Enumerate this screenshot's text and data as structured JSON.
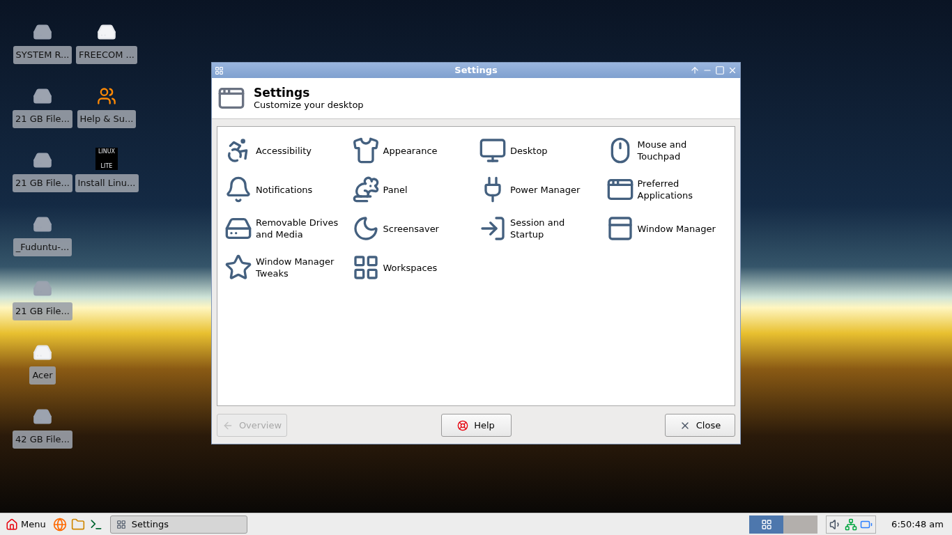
{
  "desktop_icon_columns": [
    {
      "icons": [
        {
          "label": "SYSTEM R...",
          "kind": "drive"
        },
        {
          "label": "21 GB File...",
          "kind": "drive"
        },
        {
          "label": "21 GB File...",
          "kind": "drive"
        },
        {
          "label": "_Fuduntu-...",
          "kind": "drive"
        },
        {
          "label": "21 GB File...",
          "kind": "drive"
        },
        {
          "label": "Acer",
          "kind": "drive-light"
        },
        {
          "label": "42 GB File...",
          "kind": "drive"
        }
      ]
    },
    {
      "icons": [
        {
          "label": "FREECOM ...",
          "kind": "drive-light"
        },
        {
          "label": "Help & Su...",
          "kind": "users"
        },
        {
          "label": "Install Linu...",
          "kind": "logo",
          "logo_lines": [
            "LINUX",
            "LITE"
          ]
        }
      ]
    }
  ],
  "window": {
    "title": "Settings",
    "header_title": "Settings",
    "header_subtitle": "Customize your desktop",
    "items": [
      {
        "label": "Accessibility",
        "kind": "accessibility"
      },
      {
        "label": "Appearance",
        "kind": "appearance"
      },
      {
        "label": "Desktop",
        "kind": "desktop"
      },
      {
        "label": "Mouse and Touchpad",
        "kind": "mouse"
      },
      {
        "label": "Notifications",
        "kind": "notifications"
      },
      {
        "label": "Panel",
        "kind": "panel"
      },
      {
        "label": "Power Manager",
        "kind": "power"
      },
      {
        "label": "Preferred Applications",
        "kind": "preferred"
      },
      {
        "label": "Removable Drives and Media",
        "kind": "drives"
      },
      {
        "label": "Screensaver",
        "kind": "screensaver"
      },
      {
        "label": "Session and Startup",
        "kind": "session"
      },
      {
        "label": "Window Manager",
        "kind": "wm"
      },
      {
        "label": "Window Manager Tweaks",
        "kind": "tweaks"
      },
      {
        "label": "Workspaces",
        "kind": "workspaces"
      }
    ],
    "buttons": [
      {
        "label": "Overview",
        "kind": "overview",
        "disabled": true
      },
      {
        "label": "Help",
        "kind": "help",
        "disabled": false
      },
      {
        "label": "Close",
        "kind": "close",
        "disabled": false
      }
    ]
  },
  "taskbar": {
    "menu_label": "Menu",
    "tasks": [
      {
        "label": "Settings",
        "selected": true
      }
    ],
    "workspaces": [
      {
        "selected": true
      },
      {
        "selected": false
      }
    ],
    "clock": "6:50:48 am"
  }
}
